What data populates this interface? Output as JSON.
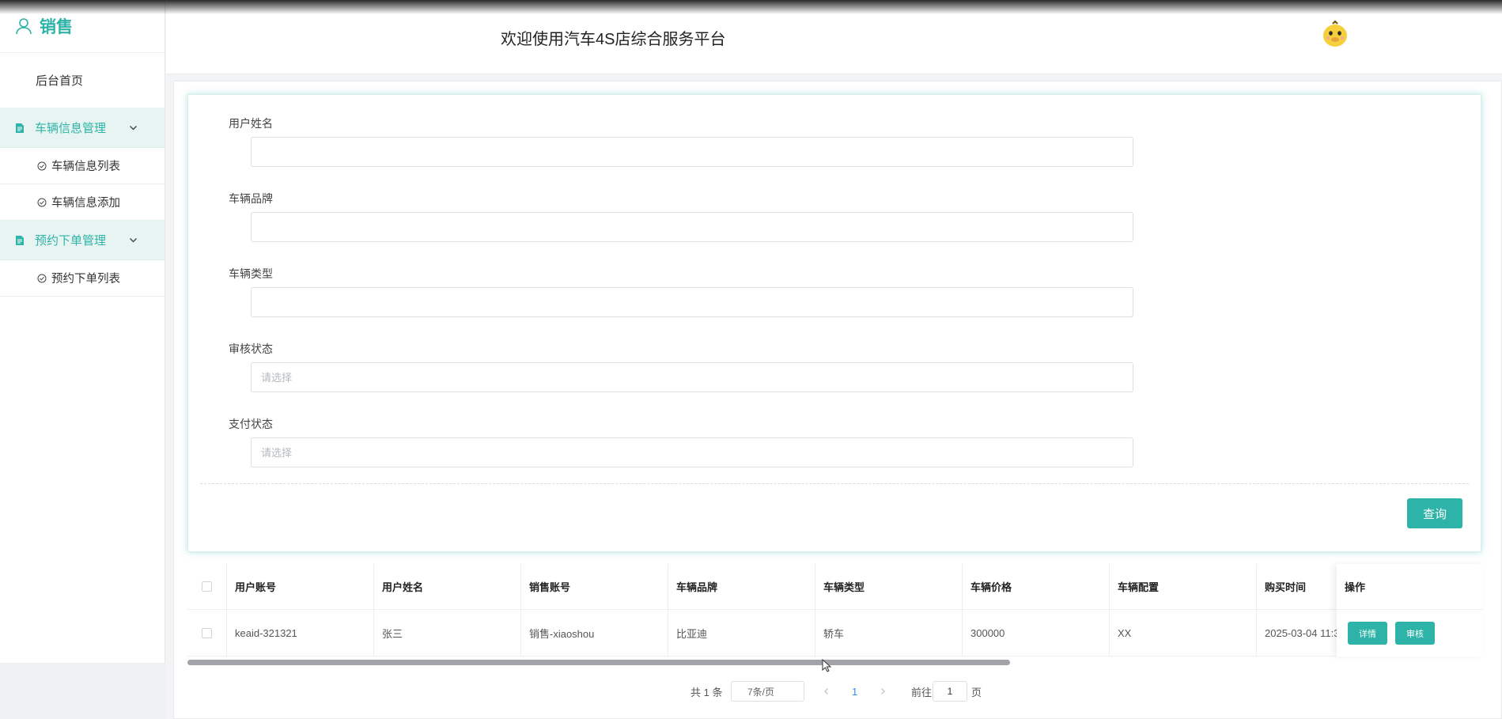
{
  "sidebar": {
    "title": "销售",
    "home": "后台首页",
    "groups": [
      {
        "label": "车辆信息管理",
        "items": [
          "车辆信息列表",
          "车辆信息添加"
        ]
      },
      {
        "label": "预约下单管理",
        "items": [
          "预约下单列表"
        ]
      }
    ]
  },
  "header": {
    "welcome": "欢迎使用汽车4S店综合服务平台"
  },
  "search": {
    "fields": [
      {
        "label": "用户姓名",
        "placeholder": ""
      },
      {
        "label": "车辆品牌",
        "placeholder": ""
      },
      {
        "label": "车辆类型",
        "placeholder": ""
      },
      {
        "label": "审核状态",
        "placeholder": "请选择"
      },
      {
        "label": "支付状态",
        "placeholder": "请选择"
      }
    ],
    "query_label": "查询"
  },
  "table": {
    "columns": [
      "用户账号",
      "用户姓名",
      "销售账号",
      "车辆品牌",
      "车辆类型",
      "车辆价格",
      "车辆配置",
      "购买时间",
      "操作"
    ],
    "rows": [
      {
        "cells": [
          "keaid-321321",
          "张三",
          "销售-xiaoshou",
          "比亚迪",
          "轿车",
          "300000",
          "XX",
          "2025-03-04 11:3"
        ]
      }
    ],
    "actions": {
      "detail": "详情",
      "review": "审核"
    }
  },
  "pagination": {
    "total": "共 1 条",
    "page_size": "7条/页",
    "current_page": "1",
    "goto_prefix": "前往",
    "goto_value": "1",
    "goto_suffix": "页"
  },
  "colors": {
    "accent": "#2db3a7",
    "group_bg": "#e8f4f2"
  },
  "icons": [
    "user-icon",
    "document-icon",
    "chevron-down-icon",
    "check-circle-icon",
    "avatar",
    "chevron-left-icon",
    "chevron-right-icon"
  ]
}
